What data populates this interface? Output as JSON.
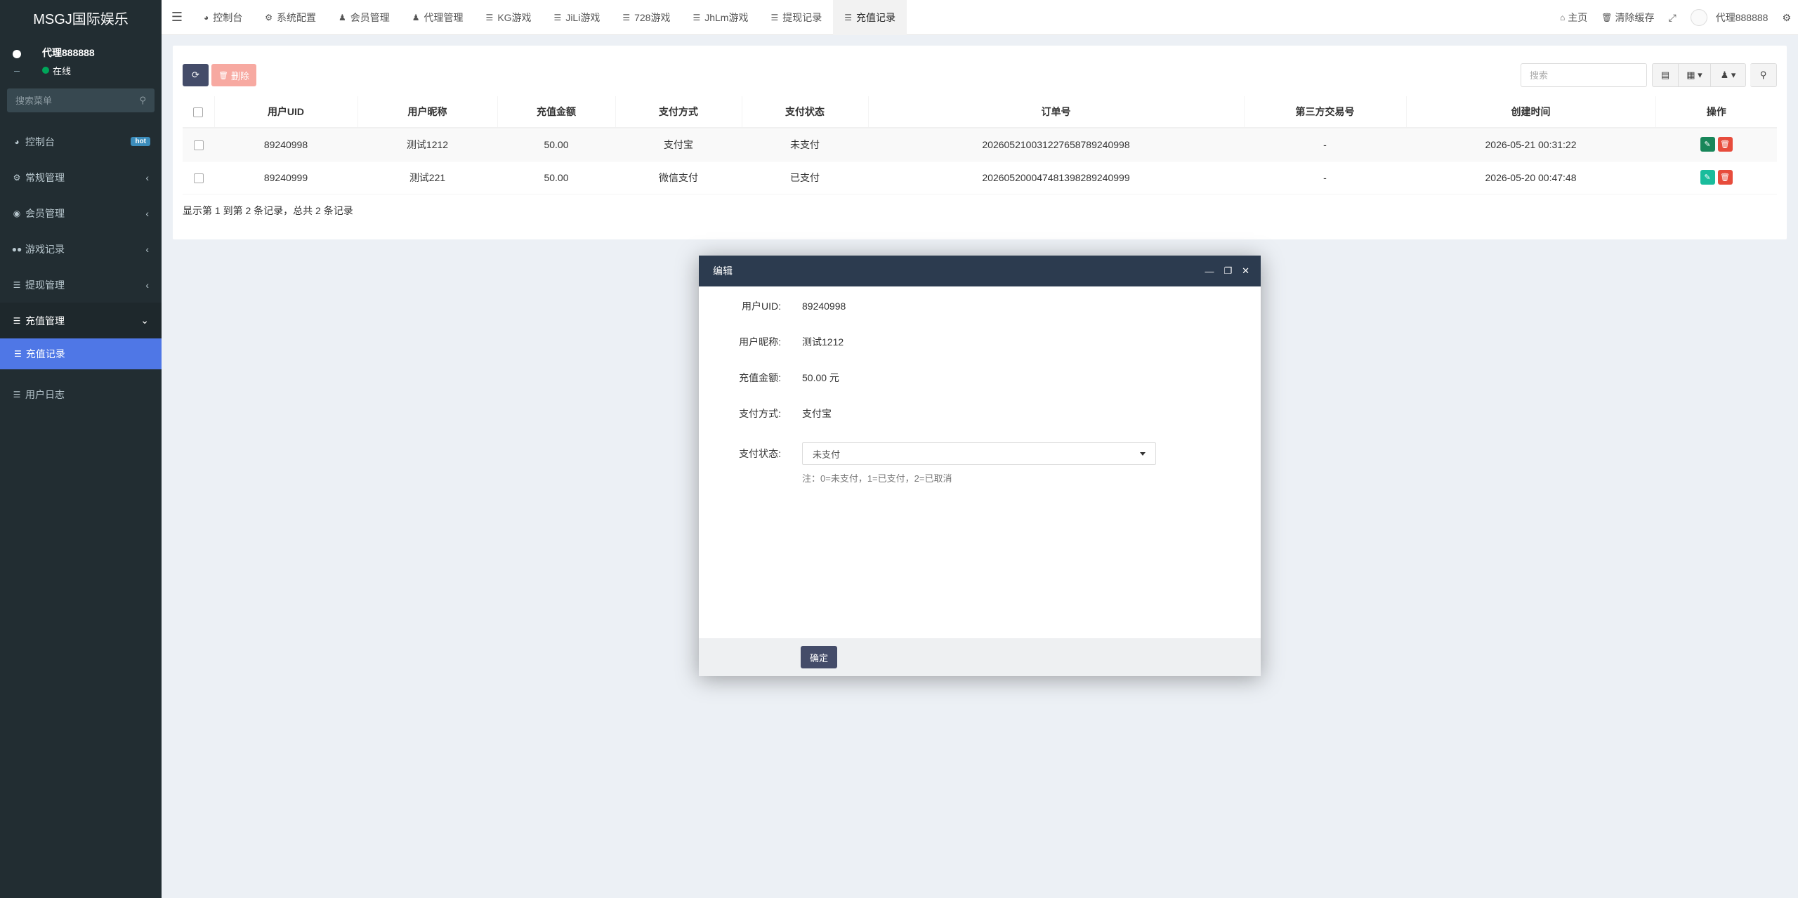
{
  "sidebar": {
    "brand": "MSGJ国际娱乐",
    "user_name": "代理888888",
    "user_status": "在线",
    "search_placeholder": "搜索菜单",
    "hot_badge": "hot",
    "items": [
      {
        "label": "控制台",
        "icon": "dashboard-icon"
      },
      {
        "label": "常规管理",
        "icon": "cogs-icon"
      },
      {
        "label": "会员管理",
        "icon": "user-circle-icon"
      },
      {
        "label": "游戏记录",
        "icon": "gamepad-icon"
      },
      {
        "label": "提现管理",
        "icon": "database-icon"
      },
      {
        "label": "充值管理",
        "icon": "database-icon"
      }
    ],
    "sub_active": "充值记录",
    "log": "用户日志"
  },
  "navbar": {
    "tabs": [
      {
        "label": "控制台",
        "icon": "dashboard-icon"
      },
      {
        "label": "系统配置",
        "icon": "cog-icon"
      },
      {
        "label": "会员管理",
        "icon": "user-icon"
      },
      {
        "label": "代理管理",
        "icon": "users-icon"
      },
      {
        "label": "KG游戏",
        "icon": "list-icon"
      },
      {
        "label": "JiLi游戏",
        "icon": "list-icon"
      },
      {
        "label": "728游戏",
        "icon": "list-icon"
      },
      {
        "label": "JhLm游戏",
        "icon": "list-icon"
      },
      {
        "label": "提现记录",
        "icon": "database-icon"
      },
      {
        "label": "充值记录",
        "icon": "database-icon"
      }
    ],
    "home": "主页",
    "clear_cache": "清除缓存",
    "user": "代理888888"
  },
  "toolbar": {
    "delete_label": "删除",
    "search_placeholder": "搜索"
  },
  "table": {
    "columns": [
      "用户UID",
      "用户昵称",
      "充值金额",
      "支付方式",
      "支付状态",
      "订单号",
      "第三方交易号",
      "创建时间",
      "操作"
    ],
    "rows": [
      {
        "uid": "89240998",
        "nickname": "测试1212",
        "amount": "50.00",
        "method": "支付宝",
        "status": "未支付",
        "order": "202605210031227658789240998",
        "third": "-",
        "created": "2026-05-21 00:31:22"
      },
      {
        "uid": "89240999",
        "nickname": "测试221",
        "amount": "50.00",
        "method": "微信支付",
        "status": "已支付",
        "order": "202605200047481398289240999",
        "third": "-",
        "created": "2026-05-20 00:47:48"
      }
    ],
    "pagination_info": "显示第 1 到第 2 条记录，总共 2 条记录"
  },
  "modal": {
    "title": "编辑",
    "fields": [
      {
        "label": "用户UID:",
        "value": "89240998"
      },
      {
        "label": "用户昵称:",
        "value": "测试1212"
      },
      {
        "label": "充值金额:",
        "value": "50.00 元"
      },
      {
        "label": "支付方式:",
        "value": "支付宝"
      }
    ],
    "status_label": "支付状态:",
    "status_value": "未支付",
    "hint": "注：0=未支付，1=已支付，2=已取消",
    "ok_label": "确定"
  },
  "colors": {
    "sidebar_bg": "#222d32",
    "submenu_active": "#4f77e6",
    "modal_header": "#2c3b4f",
    "primary_button": "#444c69",
    "danger_light": "#f7a9a1",
    "status_online": "#00a65a"
  }
}
